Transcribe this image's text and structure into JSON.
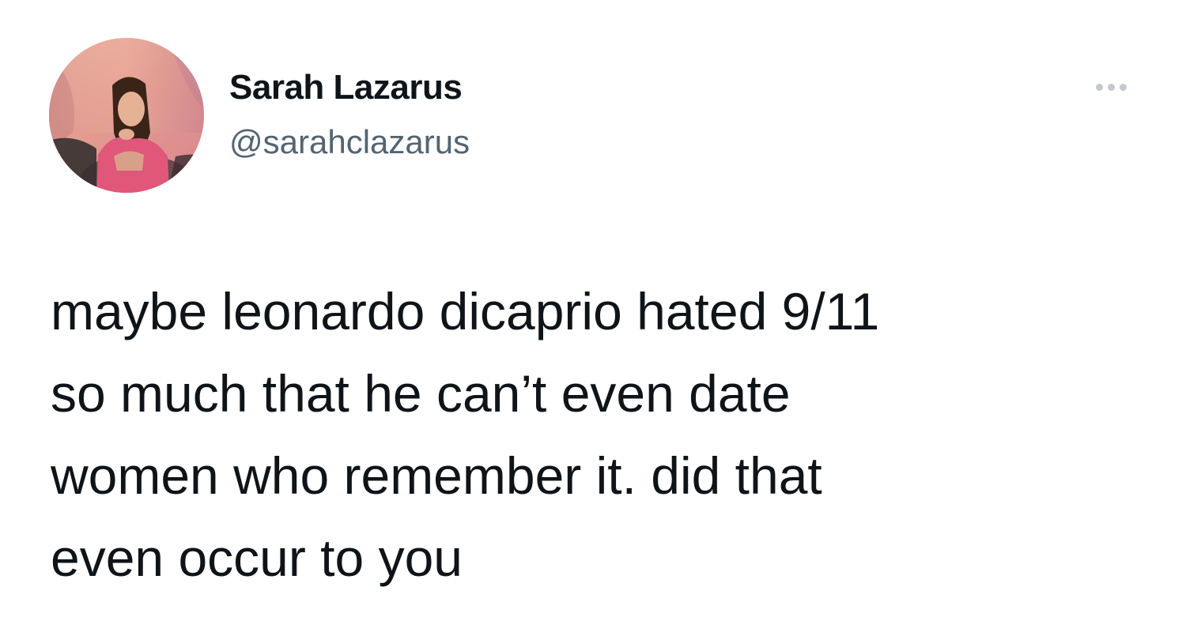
{
  "author": {
    "display_name": "Sarah Lazarus",
    "handle": "@sarahclazarus"
  },
  "tweet": {
    "text_lines": [
      "maybe leonardo dicaprio hated 9/11",
      "so much that he can’t even date",
      "women who remember it. did that",
      "even occur to you"
    ]
  },
  "icons": {
    "more": "more-options-icon"
  },
  "colors": {
    "text_primary": "#0f1419",
    "text_secondary": "#536471",
    "more_dots": "#c3c9ce",
    "background": "#ffffff"
  }
}
